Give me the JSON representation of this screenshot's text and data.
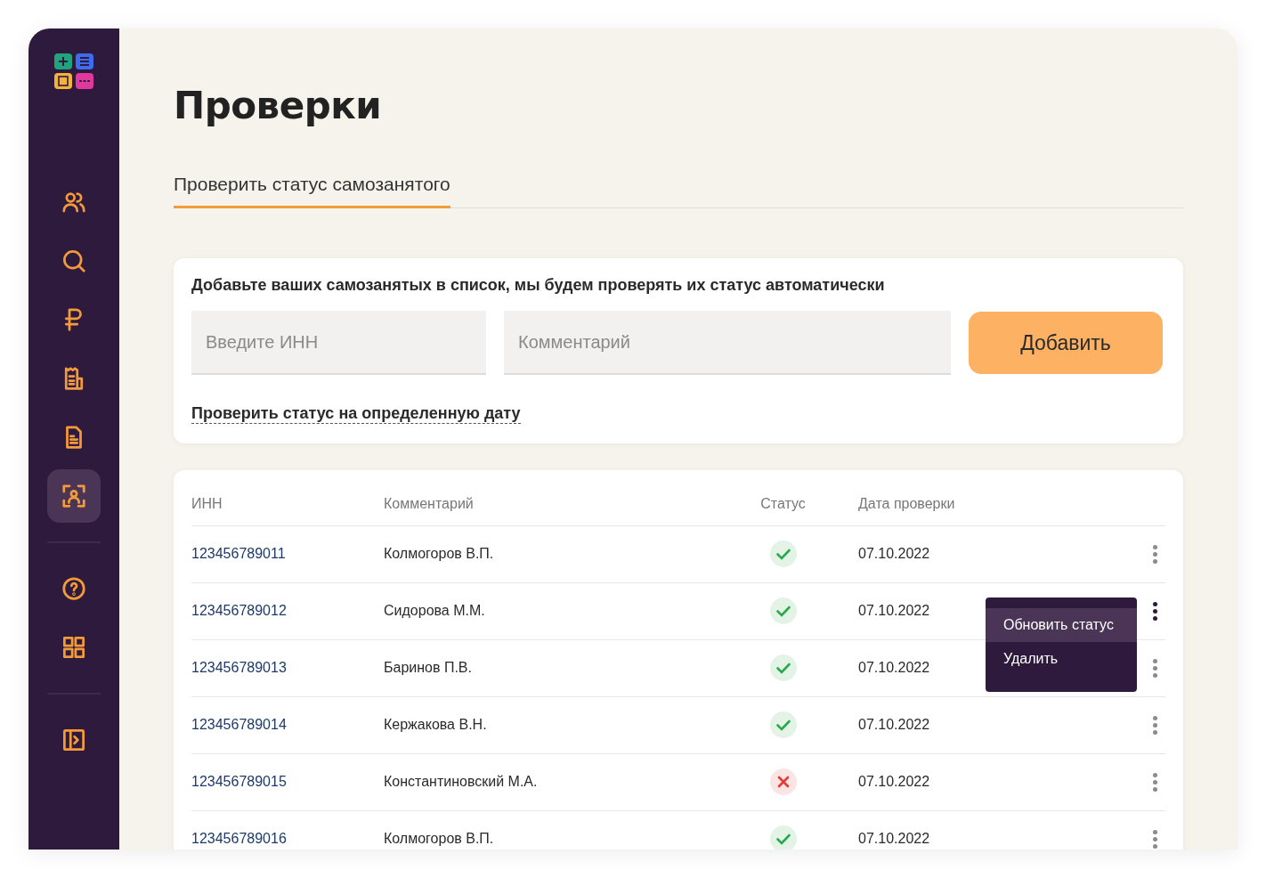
{
  "sidebar": {
    "items": [
      {
        "kind": "button",
        "selected": false
      },
      {
        "kind": "button",
        "selected": false
      },
      {
        "kind": "button",
        "selected": false
      },
      {
        "kind": "button",
        "selected": false
      },
      {
        "kind": "button",
        "selected": false
      },
      {
        "kind": "button",
        "selected": true
      },
      {
        "kind": "divider"
      },
      {
        "kind": "button",
        "selected": false
      },
      {
        "kind": "button",
        "selected": false
      },
      {
        "kind": "divider"
      },
      {
        "kind": "button",
        "selected": false
      }
    ]
  },
  "title": "Проверки",
  "tabs": [
    {
      "label": "Проверить статус самозанятого",
      "selected": true
    }
  ],
  "add_card": {
    "heading": "Добавьте ваших самозанятых в список, мы будем проверять их статус автоматически",
    "inn_placeholder": "Введите ИНН",
    "comment_placeholder": "Комментарий",
    "button": "Добавить",
    "date_link": "Проверить статус на определенную дату"
  },
  "table": {
    "columns": [
      "ИНН",
      "Комментарий",
      "Статус",
      "Дата проверки"
    ],
    "rows": [
      {
        "inn": "123456789011",
        "comment": "Колмогоров В.П.",
        "verified": true,
        "date": "07.10.2022",
        "menu_open": false
      },
      {
        "inn": "123456789012",
        "comment": "Сидорова М.М.",
        "verified": true,
        "date": "07.10.2022",
        "menu_open": true
      },
      {
        "inn": "123456789013",
        "comment": "Баринов П.В.",
        "verified": true,
        "date": "07.10.2022",
        "menu_open": false
      },
      {
        "inn": "123456789014",
        "comment": "Кержакова В.Н.",
        "verified": true,
        "date": "07.10.2022",
        "menu_open": false
      },
      {
        "inn": "123456789015",
        "comment": "Константиновский М.А.",
        "verified": false,
        "date": "07.10.2022",
        "menu_open": false
      },
      {
        "inn": "123456789016",
        "comment": "Колмогоров В.П.",
        "verified": true,
        "date": "07.10.2022",
        "menu_open": false
      }
    ],
    "row_menu": [
      {
        "label": "Обновить статус",
        "selected": true
      },
      {
        "label": "Удалить",
        "selected": false
      }
    ]
  }
}
